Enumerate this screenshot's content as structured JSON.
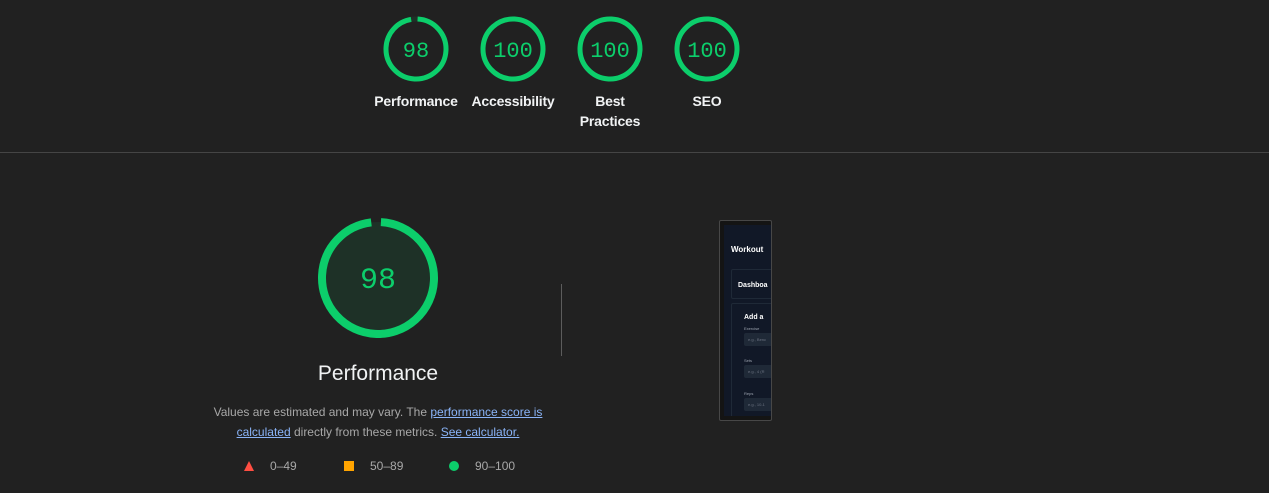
{
  "colors": {
    "pass": "#0cce6b",
    "pass_fill": "#1e3127",
    "average": "#ffa400",
    "fail": "#ff4e42",
    "link": "#8ab4f8",
    "background": "#212121"
  },
  "summary_gauges": [
    {
      "score": "98",
      "value": 98,
      "label": "Performance"
    },
    {
      "score": "100",
      "value": 100,
      "label": "Accessibility"
    },
    {
      "score": "100",
      "value": 100,
      "label": "Best Practices"
    },
    {
      "score": "100",
      "value": 100,
      "label": "SEO"
    }
  ],
  "performance": {
    "score": "98",
    "value": 98,
    "title": "Performance",
    "desc_prefix": "Values are estimated and may vary. The ",
    "desc_link": "performance score is calculated",
    "desc_middle": " directly from these metrics. ",
    "desc_calc_link": "See calculator."
  },
  "legend": [
    {
      "icon": "triangle-icon",
      "range": "0–49"
    },
    {
      "icon": "square-icon",
      "range": "50–89"
    },
    {
      "icon": "circle-icon",
      "range": "90–100"
    }
  ],
  "screenshot": {
    "app_title": "Workout",
    "dashboard": "Dashboa",
    "section_title": "Add a",
    "exercise_label": "Exercise",
    "exercise_placeholder": "e.g., Benc",
    "sets_label": "Sets",
    "sets_placeholder": "e.g., 4 (R",
    "reps_label": "Reps",
    "reps_placeholder": "e.g., 10-1"
  }
}
